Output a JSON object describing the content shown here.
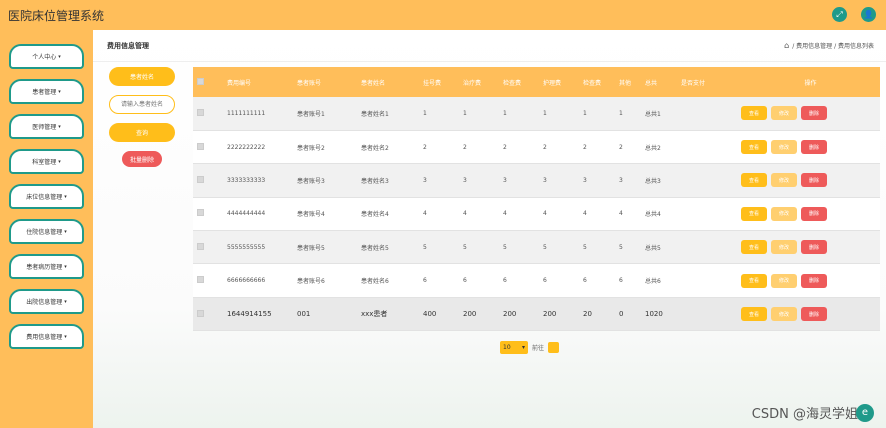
{
  "app": {
    "title": "医院床位管理系统",
    "fullscreen_icon": "⤢",
    "user_icon": "👤"
  },
  "sidebar": {
    "items": [
      {
        "label": "个人中心"
      },
      {
        "label": "患者管理"
      },
      {
        "label": "医师管理"
      },
      {
        "label": "科室管理"
      },
      {
        "label": "床位信息管理"
      },
      {
        "label": "住院信息管理"
      },
      {
        "label": "患者病历管理"
      },
      {
        "label": "出院信息管理"
      },
      {
        "label": "费用信息管理"
      }
    ],
    "caret": "▾"
  },
  "breadcrumb": {
    "page_title": "费用信息管理",
    "home_icon": "⌂",
    "path": "/ 费用信息管理 / 费用信息列表"
  },
  "search": {
    "field_label": "患者姓名",
    "placeholder": "请输入患者姓名",
    "search_button": "查询",
    "batch_delete": "批量删除"
  },
  "table": {
    "headers": [
      "",
      "费用编号",
      "患者账号",
      "患者姓名",
      "挂号费",
      "治疗费",
      "检查费",
      "护理费",
      "检查费",
      "其他",
      "总共",
      "是否支付",
      "操作"
    ],
    "rows": [
      [
        "1111111111",
        "患者账号1",
        "患者姓名1",
        "1",
        "1",
        "1",
        "1",
        "1",
        "1",
        "总共1",
        ""
      ],
      [
        "2222222222",
        "患者账号2",
        "患者姓名2",
        "2",
        "2",
        "2",
        "2",
        "2",
        "2",
        "总共2",
        ""
      ],
      [
        "3333333333",
        "患者账号3",
        "患者姓名3",
        "3",
        "3",
        "3",
        "3",
        "3",
        "3",
        "总共3",
        ""
      ],
      [
        "4444444444",
        "患者账号4",
        "患者姓名4",
        "4",
        "4",
        "4",
        "4",
        "4",
        "4",
        "总共4",
        ""
      ],
      [
        "5555555555",
        "患者账号5",
        "患者姓名5",
        "5",
        "5",
        "5",
        "5",
        "5",
        "5",
        "总共5",
        ""
      ],
      [
        "6666666666",
        "患者账号6",
        "患者姓名6",
        "6",
        "6",
        "6",
        "6",
        "6",
        "6",
        "总共6",
        ""
      ],
      [
        "1644914155",
        "001",
        "xxx患者",
        "400",
        "200",
        "200",
        "200",
        "20",
        "0",
        "1020",
        ""
      ]
    ],
    "actions": {
      "view": "查看",
      "edit": "修改",
      "delete": "删除"
    }
  },
  "pagination": {
    "page_size": "10",
    "goto_label": "前往"
  },
  "watermark": {
    "text": "CSDN @海灵学姐",
    "badge": "e"
  }
}
